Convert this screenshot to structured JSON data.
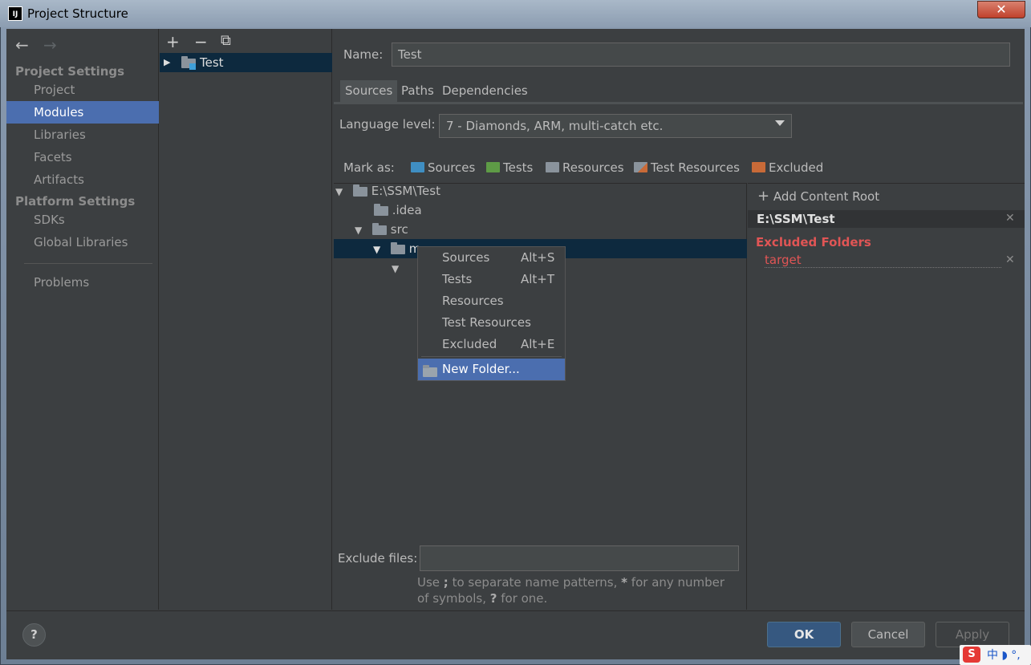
{
  "window": {
    "title": "Project Structure",
    "close_glyph": "✕"
  },
  "nav": {
    "back_glyph": "←",
    "forward_glyph": "→",
    "project_settings": "Project Settings",
    "items_project": [
      "Project",
      "Modules",
      "Libraries",
      "Facets",
      "Artifacts"
    ],
    "platform_settings": "Platform Settings",
    "items_platform": [
      "SDKs",
      "Global Libraries"
    ],
    "problems": "Problems",
    "selected": "Modules"
  },
  "modules": {
    "add_glyph": "+",
    "remove_glyph": "−",
    "copy_glyph": "⧉",
    "module_name": "Test"
  },
  "name_field": {
    "label": "Name:",
    "value": "Test"
  },
  "tabs": [
    "Sources",
    "Paths",
    "Dependencies"
  ],
  "language": {
    "label": "Language level:",
    "value": "7 - Diamonds, ARM, multi-catch etc."
  },
  "mark_as": {
    "label": "Mark as:",
    "items": [
      "Sources",
      "Tests",
      "Resources",
      "Test Resources",
      "Excluded"
    ],
    "colors": {
      "sources": "#3f8ec2",
      "tests": "#5e9b46",
      "resources": "#8a939c",
      "test_resources": "#8a939c",
      "excluded": "#c86a38"
    }
  },
  "tree": {
    "root": "E:\\SSM\\Test",
    "idea": ".idea",
    "src": "src",
    "main_partial": "m"
  },
  "context_menu": {
    "items": [
      {
        "label": "Sources",
        "shortcut": "Alt+S"
      },
      {
        "label": "Tests",
        "shortcut": "Alt+T"
      },
      {
        "label": "Resources",
        "shortcut": ""
      },
      {
        "label": "Test Resources",
        "shortcut": ""
      },
      {
        "label": "Excluded",
        "shortcut": "Alt+E"
      }
    ],
    "new_folder": "New Folder..."
  },
  "content_roots": {
    "add_label": "Add Content Root",
    "root_path": "E:\\SSM\\Test",
    "excluded_title": "Excluded Folders",
    "excluded_items": [
      "target"
    ]
  },
  "exclude_files": {
    "label": "Exclude files:",
    "value": "",
    "hint_pre": "Use ",
    "hint_semicolon": ";",
    "hint_mid": " to separate name patterns, ",
    "hint_star": "*",
    "hint_mid2": " for any number of symbols, ",
    "hint_q": "?",
    "hint_end": " for one."
  },
  "buttons": {
    "help": "?",
    "ok": "OK",
    "cancel": "Cancel",
    "apply": "Apply"
  },
  "ime": {
    "logo": "S",
    "text": "中 ◗ °,"
  }
}
